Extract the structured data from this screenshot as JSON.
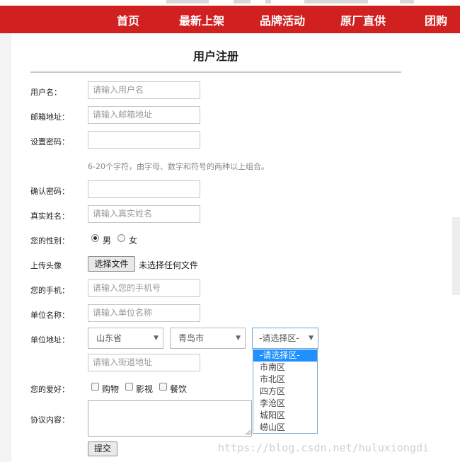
{
  "nav": {
    "items": [
      "首页",
      "最新上架",
      "品牌活动",
      "原厂直供",
      "团购"
    ],
    "bg_color": "#d0201f"
  },
  "form": {
    "title": "用户注册",
    "username": {
      "label": "用户名：",
      "placeholder": "请输入用户名"
    },
    "email": {
      "label": "邮箱地址：",
      "placeholder": "请输入邮箱地址"
    },
    "password": {
      "label": "设置密码：",
      "placeholder": "",
      "hint": "6-20个字符，由字母、数字和符号的两种以上组合。"
    },
    "confirm": {
      "label": "确认密码：",
      "placeholder": ""
    },
    "realname": {
      "label": "真实姓名：",
      "placeholder": "请输入真实姓名"
    },
    "gender": {
      "label": "您的性别：",
      "options": [
        "男",
        "女"
      ],
      "selected": "男"
    },
    "avatar": {
      "label": "上传头像",
      "button": "选择文件",
      "status": "未选择任何文件"
    },
    "phone": {
      "label": "您的手机：",
      "placeholder": "请输入您的手机号"
    },
    "company": {
      "label": "单位名称：",
      "placeholder": "请输入单位名称"
    },
    "address": {
      "label": "单位地址：",
      "province": "山东省",
      "city": "青岛市",
      "district": "-请选择区-",
      "district_options": [
        "-请选择区-",
        "市南区",
        "市北区",
        "四方区",
        "李沧区",
        "城阳区",
        "崂山区"
      ],
      "street_placeholder": "请输入街道地址"
    },
    "hobbies": {
      "label": "您的爱好：",
      "options": [
        "购物",
        "影视",
        "餐饮"
      ]
    },
    "agreement": {
      "label": "协议内容："
    },
    "submit": "提交"
  },
  "watermark": "https://blog.csdn.net/huluxiongdi"
}
